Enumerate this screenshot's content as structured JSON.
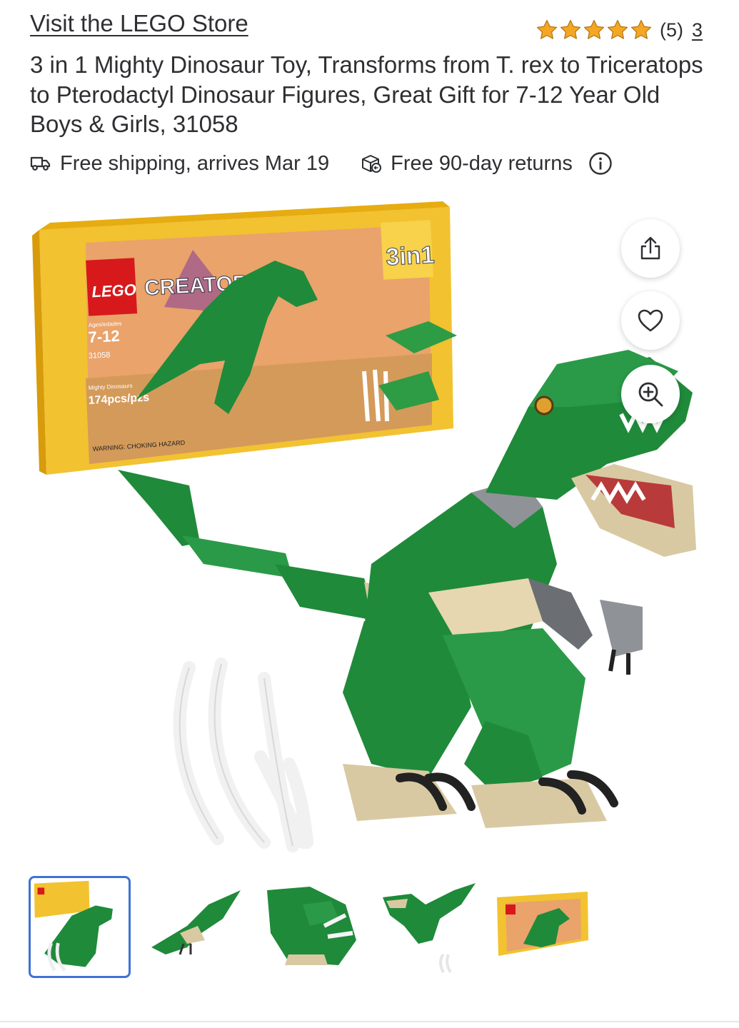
{
  "store": {
    "link_label": "Visit the LEGO Store"
  },
  "rating": {
    "stars": 5,
    "count_label": "(5)",
    "reviews_label": "3",
    "star_color": "#f5a623"
  },
  "product": {
    "title": "3 in 1 Mighty Dinosaur Toy, Transforms from T. rex to Triceratops to Pterodactyl Dinosaur Figures, Great Gift for 7-12 Year Old Boys & Girls, 31058"
  },
  "badges": {
    "shipping_label": "Free shipping, arrives Mar 19",
    "returns_label": "Free 90-day returns",
    "shipping_icon": "truck-icon",
    "returns_icon": "return-box-icon",
    "info_icon": "info-icon"
  },
  "box": {
    "brand": "LEGO",
    "line": "CREATOR",
    "age_label": "Ages/edades",
    "age": "7-12",
    "set_number": "31058",
    "set_name": "Mighty Dinosaurs",
    "pieces": "174pcs/pzs",
    "badge": "3in1",
    "warning": "WARNING: CHOKING HAZARD"
  },
  "actions": {
    "share_icon": "share-icon",
    "favorite_icon": "heart-icon",
    "zoom_icon": "zoom-in-icon"
  },
  "thumbnails": {
    "selected_index": 0,
    "accent": "#3e72d8",
    "items": [
      "t-rex-with-box",
      "pterodactyl",
      "triceratops",
      "t-rex-side",
      "box-front"
    ]
  }
}
